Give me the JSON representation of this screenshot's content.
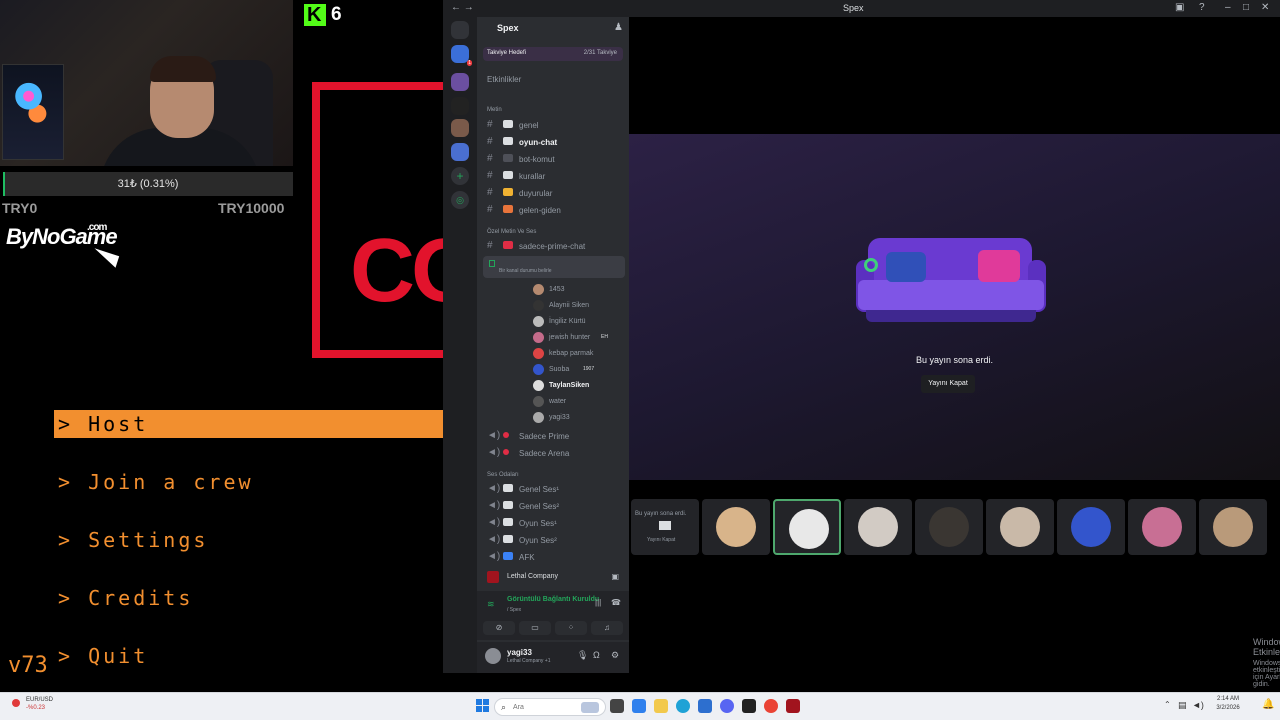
{
  "stream": {
    "kick_count": "6",
    "donation": {
      "text": "31₺ (0.31%)",
      "progress_fraction": 0.0031,
      "min": "TRY0",
      "max": "TRY10000"
    },
    "brand": {
      "name": "ByNoGame",
      "suffix": ".com"
    },
    "game_menu": {
      "items": [
        {
          "label": "> Host",
          "selected": true
        },
        {
          "label": "> Join a crew"
        },
        {
          "label": "> Settings"
        },
        {
          "label": "> Credits"
        },
        {
          "label": "> Quit"
        }
      ],
      "version": "v73"
    },
    "accent": "#f28f2f"
  },
  "discord": {
    "window_title": "Spex",
    "server": {
      "name": "Spex",
      "boost_label": "Takviye Hedefi",
      "boost_progress": "2/31 Takviye",
      "events_label": "Etkinlikler"
    },
    "categories": {
      "text": "Metin",
      "private_voice": "Özel Metin Ve Ses",
      "voice_rooms": "Ses Odaları"
    },
    "text_channels": [
      {
        "name": "genel",
        "color": "#f2f3f5"
      },
      {
        "name": "oyun-chat",
        "active": true,
        "color": "#f2f3f5"
      },
      {
        "name": "bot-komut",
        "color": "#2b2d31"
      },
      {
        "name": "kurallar",
        "color": "#dbdee1"
      },
      {
        "name": "duyurular",
        "color": "#f0b232"
      },
      {
        "name": "gelen-giden",
        "color": "#e8743b"
      }
    ],
    "prime_chat": "sadece-prime-chat",
    "live_voice_status": "Bir kanal durumu belirle",
    "members": [
      {
        "name": "1453"
      },
      {
        "name": "Alaynii Siken"
      },
      {
        "name": "İngiliz Kürtü"
      },
      {
        "name": "jewish hunter",
        "tag": "EH"
      },
      {
        "name": "kebap parmak"
      },
      {
        "name": "Suoba",
        "tag": "1907"
      },
      {
        "name": "TaylanSiken",
        "bold": true
      },
      {
        "name": "water"
      },
      {
        "name": "yagi33"
      }
    ],
    "voice_channels": [
      {
        "name": "Sadece Prime"
      },
      {
        "name": "Sadece Arena"
      },
      {
        "name": "Genel Ses¹"
      },
      {
        "name": "Genel Ses²"
      },
      {
        "name": "Oyun Ses¹"
      },
      {
        "name": "Oyun Ses²"
      },
      {
        "name": "AFK"
      }
    ],
    "activity_game": "Lethal Company",
    "voice_status": {
      "title": "Görüntülü Bağlantı Kuruldu",
      "sub": "/ Spex"
    },
    "user": {
      "name": "yagi33",
      "status": "Lethal Company +1"
    },
    "stage": {
      "ended_text": "Bu yayın sona erdi.",
      "close_button": "Yayını Kapat",
      "tile0_line1": "Bu yayın sona erdi.",
      "tile0_line2": "Yayını Kapat"
    },
    "tile_colors": [
      "#d8b48a",
      "#e8e8e8",
      "#d2cbc4",
      "#3a3632",
      "#c9b9a8",
      "#3355cc",
      "#c86f94",
      "#b99a7a"
    ],
    "windows_activation": {
      "title": "Windows'u Etkinleştir",
      "sub": "Windows'u etkinleştirmek için Ayarlar'a gidin."
    }
  },
  "taskbar": {
    "ticker": {
      "pair": "EUR/USD",
      "change": "-%0.23"
    },
    "search_placeholder": "Ara",
    "clock_time": "2:14 AM",
    "clock_date": "3/2/2026"
  }
}
